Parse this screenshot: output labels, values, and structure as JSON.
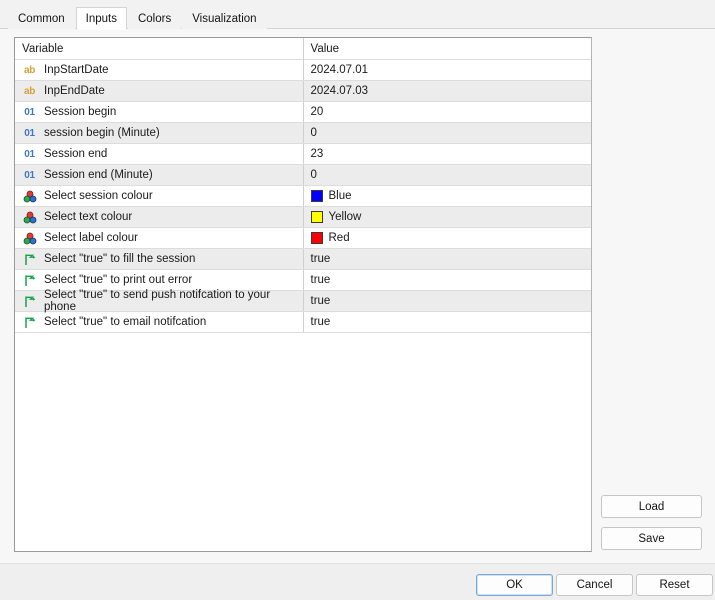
{
  "window": {
    "title": "Inputs"
  },
  "tabs": [
    {
      "label": "Common",
      "selected": false
    },
    {
      "label": "Inputs",
      "selected": true
    },
    {
      "label": "Colors",
      "selected": false
    },
    {
      "label": "Visualization",
      "selected": false
    }
  ],
  "table": {
    "headers": {
      "variable": "Variable",
      "value": "Value"
    },
    "rows": [
      {
        "icon": "string-type-icon",
        "variable": "InpStartDate",
        "value": "2024.07.01",
        "value_kind": "text"
      },
      {
        "icon": "string-type-icon",
        "variable": "InpEndDate",
        "value": "2024.07.03",
        "value_kind": "text"
      },
      {
        "icon": "integer-type-icon",
        "variable": "Session begin",
        "value": "20",
        "value_kind": "text"
      },
      {
        "icon": "integer-type-icon",
        "variable": "session begin (Minute)",
        "value": "0",
        "value_kind": "text"
      },
      {
        "icon": "integer-type-icon",
        "variable": "Session end",
        "value": "23",
        "value_kind": "text"
      },
      {
        "icon": "integer-type-icon",
        "variable": "Session end (Minute)",
        "value": "0",
        "value_kind": "text"
      },
      {
        "icon": "color-type-icon",
        "variable": "Select session colour",
        "value": "Blue",
        "value_kind": "color",
        "swatch": "#0000FF"
      },
      {
        "icon": "color-type-icon",
        "variable": "Select text colour",
        "value": "Yellow",
        "value_kind": "color",
        "swatch": "#FFFF00"
      },
      {
        "icon": "color-type-icon",
        "variable": "Select label colour",
        "value": "Red",
        "value_kind": "color",
        "swatch": "#FF0000"
      },
      {
        "icon": "boolean-type-icon",
        "variable": "Select \"true\" to fill the session",
        "value": "true",
        "value_kind": "text"
      },
      {
        "icon": "boolean-type-icon",
        "variable": "Select \"true\" to print out error",
        "value": "true",
        "value_kind": "text"
      },
      {
        "icon": "boolean-type-icon",
        "variable": "Select \"true\" to send push notifcation to your phone",
        "value": "true",
        "value_kind": "text"
      },
      {
        "icon": "boolean-type-icon",
        "variable": "Select \"true\" to email notifcation",
        "value": "true",
        "value_kind": "text"
      }
    ]
  },
  "side_buttons": {
    "load": "Load",
    "save": "Save"
  },
  "dialog_buttons": {
    "ok": "OK",
    "cancel": "Cancel",
    "reset": "Reset"
  },
  "colors": {
    "string_icon": "#d5a03a",
    "integer_icon": "#3b79c4",
    "alt_row": "#ececec",
    "panel_border": "#9a9a9a",
    "focus_border": "#7aa7d4"
  }
}
